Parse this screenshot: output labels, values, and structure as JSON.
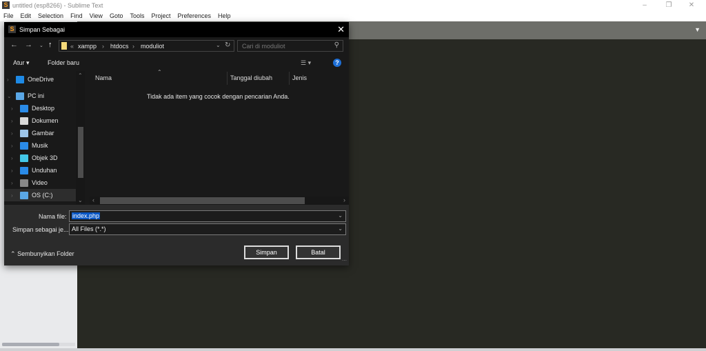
{
  "window": {
    "title": "untitled (esp8266) - Sublime Text",
    "app_icon": "S",
    "controls": [
      "minimize",
      "restore",
      "close"
    ]
  },
  "menu": [
    "File",
    "Edit",
    "Selection",
    "Find",
    "View",
    "Goto",
    "Tools",
    "Project",
    "Preferences",
    "Help"
  ],
  "dialog": {
    "title": "Simpan Sebagai",
    "breadcrumb": {
      "prefix": "«",
      "parts": [
        "xampp",
        "htdocs",
        "moduliot"
      ]
    },
    "search_placeholder": "Cari di moduliot",
    "toolbar": {
      "organize": "Atur",
      "new_folder": "Folder baru",
      "help": "?"
    },
    "nav_items": [
      {
        "label": "OneDrive",
        "icon": "cloud-icon",
        "color": "#1e8ae6"
      },
      {
        "label": "PC ini",
        "icon": "computer-icon",
        "color": "#5aa7e6"
      },
      {
        "label": "Desktop",
        "icon": "desktop-icon",
        "color": "#2a8be8"
      },
      {
        "label": "Dokumen",
        "icon": "document-icon",
        "color": "#d9d9d9"
      },
      {
        "label": "Gambar",
        "icon": "picture-icon",
        "color": "#9cc4e8"
      },
      {
        "label": "Musik",
        "icon": "music-icon",
        "color": "#2a8be8"
      },
      {
        "label": "Objek 3D",
        "icon": "cube-icon",
        "color": "#43c7e8"
      },
      {
        "label": "Unduhan",
        "icon": "download-icon",
        "color": "#2a8be8"
      },
      {
        "label": "Video",
        "icon": "video-icon",
        "color": "#888888"
      },
      {
        "label": "OS (C:)",
        "icon": "drive-icon",
        "color": "#5aa7e6"
      }
    ],
    "columns": [
      "Nama",
      "Tanggal diubah",
      "Jenis"
    ],
    "empty_message": "Tidak ada item yang cocok dengan pencarian Anda.",
    "filename_label": "Nama file:",
    "filename_value": "index.php",
    "filetype_label": "Simpan sebagai je...",
    "filetype_value": "All Files (*.*)",
    "hide_folders": "Sembunyikan Folder",
    "save": "Simpan",
    "cancel": "Batal"
  }
}
